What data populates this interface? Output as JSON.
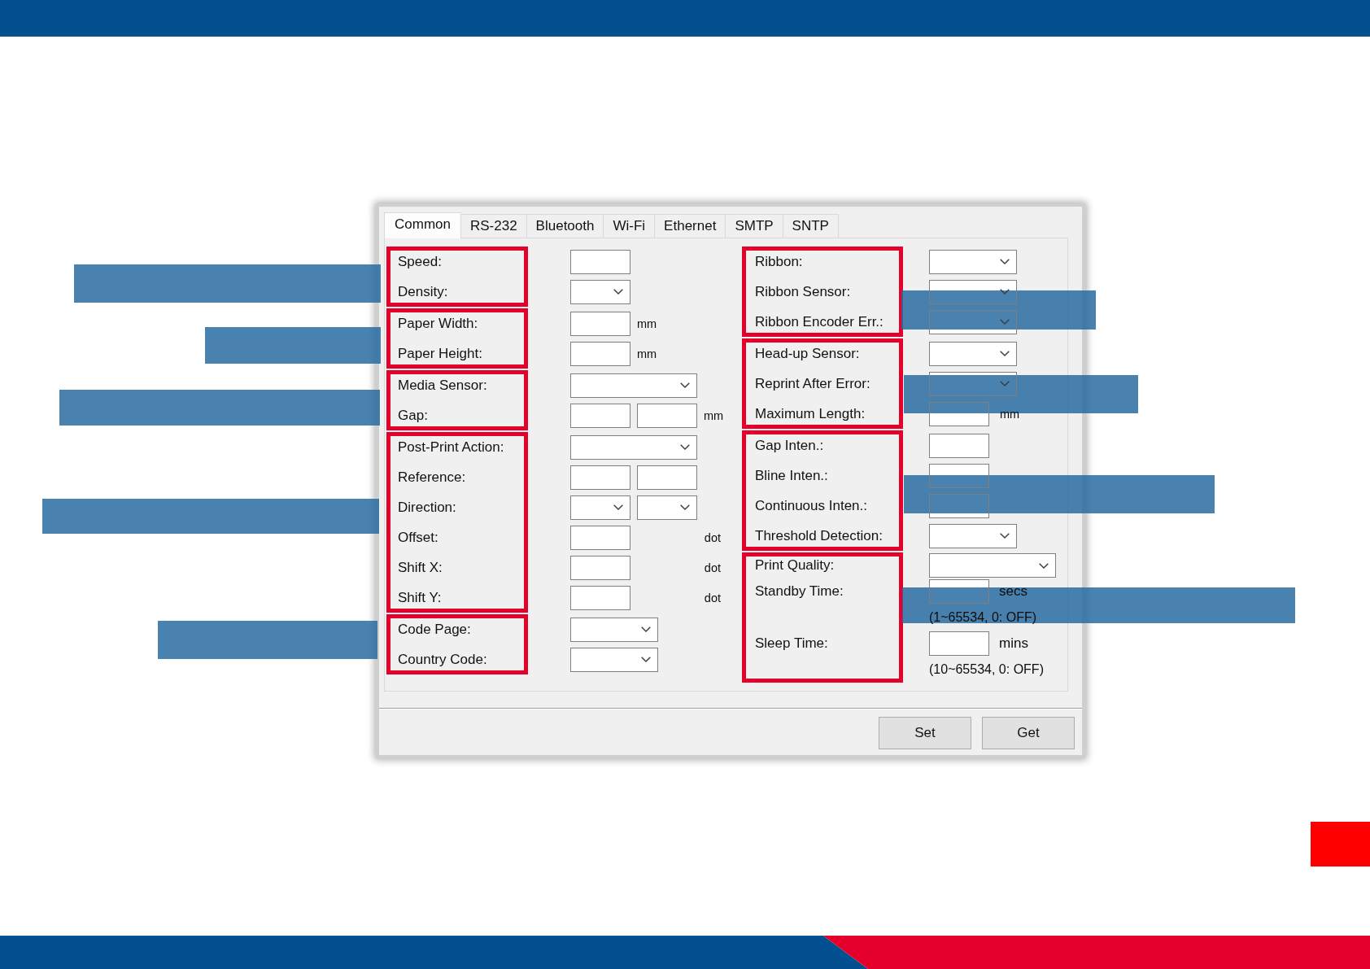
{
  "dialog": {
    "tabs": [
      {
        "label": "Common",
        "selected": true
      },
      {
        "label": "RS-232",
        "selected": false
      },
      {
        "label": "Bluetooth",
        "selected": false
      },
      {
        "label": "Wi-Fi",
        "selected": false
      },
      {
        "label": "Ethernet",
        "selected": false
      },
      {
        "label": "SMTP",
        "selected": false
      },
      {
        "label": "SNTP",
        "selected": false
      }
    ],
    "columns": [
      {
        "groups": [
          {
            "fields": [
              {
                "label": "Speed:",
                "controls": [
                  {
                    "kind": "textbox"
                  }
                ]
              },
              {
                "label": "Density:",
                "controls": [
                  {
                    "kind": "dropdown"
                  }
                ]
              }
            ]
          },
          {
            "fields": [
              {
                "label": "Paper Width:",
                "controls": [
                  {
                    "kind": "textbox"
                  },
                  {
                    "kind": "unit",
                    "text": "mm"
                  }
                ]
              },
              {
                "label": "Paper Height:",
                "controls": [
                  {
                    "kind": "textbox"
                  },
                  {
                    "kind": "unit",
                    "text": "mm"
                  }
                ]
              }
            ]
          },
          {
            "fields": [
              {
                "label": "Media Sensor:",
                "controls": [
                  {
                    "kind": "widedropdown"
                  }
                ]
              },
              {
                "label": "Gap:",
                "controls": [
                  {
                    "kind": "textbox"
                  },
                  {
                    "kind": "textbox"
                  },
                  {
                    "kind": "unit",
                    "text": "mm"
                  }
                ]
              }
            ]
          },
          {
            "fields": [
              {
                "label": "Post-Print Action:",
                "controls": [
                  {
                    "kind": "widedropdown"
                  }
                ]
              },
              {
                "label": "Reference:",
                "controls": [
                  {
                    "kind": "textbox"
                  },
                  {
                    "kind": "textbox"
                  }
                ]
              },
              {
                "label": "Direction:",
                "controls": [
                  {
                    "kind": "dropdown"
                  },
                  {
                    "kind": "dropdown"
                  }
                ]
              },
              {
                "label": "Offset:",
                "controls": [
                  {
                    "kind": "textbox"
                  },
                  {
                    "kind": "endunit",
                    "text": "dot"
                  }
                ]
              },
              {
                "label": "Shift X:",
                "controls": [
                  {
                    "kind": "textbox"
                  },
                  {
                    "kind": "endunit",
                    "text": "dot"
                  }
                ]
              },
              {
                "label": "Shift Y:",
                "controls": [
                  {
                    "kind": "textbox"
                  },
                  {
                    "kind": "endunit",
                    "text": "dot"
                  }
                ]
              }
            ]
          },
          {
            "fields": [
              {
                "label": "Code Page:",
                "controls": [
                  {
                    "kind": "middropdown"
                  }
                ]
              },
              {
                "label": "Country Code:",
                "controls": [
                  {
                    "kind": "middropdown"
                  }
                ]
              }
            ]
          }
        ]
      },
      {
        "groups": [
          {
            "fields": [
              {
                "label": "Ribbon:",
                "controls": [
                  {
                    "kind": "middropdown"
                  }
                ]
              },
              {
                "label": "Ribbon Sensor:",
                "controls": [
                  {
                    "kind": "middropdown"
                  }
                ]
              },
              {
                "label": "Ribbon Encoder Err.:",
                "controls": [
                  {
                    "kind": "middropdown"
                  }
                ]
              }
            ]
          },
          {
            "fields": [
              {
                "label": "Head-up Sensor:",
                "controls": [
                  {
                    "kind": "middropdown"
                  }
                ]
              },
              {
                "label": "Reprint After Error:",
                "controls": [
                  {
                    "kind": "middropdown"
                  }
                ]
              },
              {
                "label": "Maximum Length:",
                "controls": [
                  {
                    "kind": "textbox"
                  },
                  {
                    "kind": "unit",
                    "text": "mm"
                  }
                ]
              }
            ]
          },
          {
            "fields": [
              {
                "label": "Gap Inten.:",
                "controls": [
                  {
                    "kind": "textbox"
                  }
                ]
              },
              {
                "label": "Bline Inten.:",
                "controls": [
                  {
                    "kind": "textbox"
                  }
                ]
              },
              {
                "label": "Continuous Inten.:",
                "controls": [
                  {
                    "kind": "textbox"
                  }
                ]
              },
              {
                "label": "Threshold Detection:",
                "controls": [
                  {
                    "kind": "middropdown"
                  }
                ]
              }
            ]
          },
          {
            "fields": [
              {
                "label": "Print Quality:",
                "controls": [
                  {
                    "kind": "widedropdown"
                  }
                ]
              },
              {
                "label": "Standby Time:",
                "controls": [
                  {
                    "kind": "textbox"
                  },
                  {
                    "kind": "suffix",
                    "text": "secs"
                  }
                ],
                "note": "(1~65534, 0: OFF)"
              },
              {
                "label": "Sleep Time:",
                "controls": [
                  {
                    "kind": "textbox"
                  },
                  {
                    "kind": "suffix",
                    "text": "mins"
                  }
                ],
                "note": "(10~65534, 0: OFF)"
              }
            ]
          }
        ]
      }
    ],
    "buttons": [
      "Set",
      "Get"
    ]
  }
}
